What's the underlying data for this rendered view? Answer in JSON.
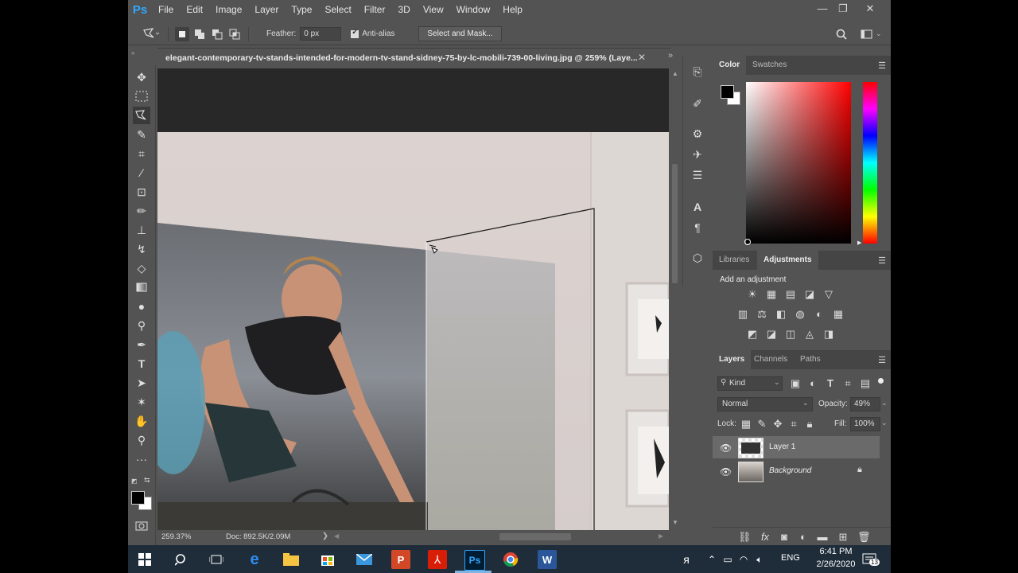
{
  "window": {
    "minimize": "—",
    "restore": "❐",
    "close": "✕"
  },
  "menu": [
    "File",
    "Edit",
    "Image",
    "Layer",
    "Type",
    "Select",
    "Filter",
    "3D",
    "View",
    "Window",
    "Help"
  ],
  "app_logo": "Ps",
  "options": {
    "feather_label": "Feather:",
    "feather_value": "0 px",
    "antialias_label": "Anti-alias",
    "antialias_checked": true,
    "select_mask_label": "Select and Mask..."
  },
  "document": {
    "tab_title": "elegant-contemporary-tv-stands-intended-for-modern-tv-stand-sidney-75-by-lc-mobili-739-00-living.jpg @ 259% (Laye...",
    "close": "✕",
    "zoom": "259.37%",
    "doc_info": "Doc: 892.5K/2.09M",
    "status_arrow": "❯"
  },
  "color_panel": {
    "tabs": [
      "Color",
      "Swatches"
    ],
    "foreground": "#000000",
    "background": "#ffffff",
    "hue_color": "#ff0000"
  },
  "adjust_panel": {
    "tabs": [
      "Libraries",
      "Adjustments"
    ],
    "heading": "Add an adjustment",
    "row1": [
      "☀",
      "▦",
      "▤",
      "◪",
      "▽"
    ],
    "row2": [
      "▥",
      "⚖",
      "◧",
      "◍",
      "◐",
      "▦"
    ],
    "row3": [
      "◩",
      "◪",
      "◫",
      "◬",
      "◨"
    ]
  },
  "layers_panel": {
    "tabs": [
      "Layers",
      "Channels",
      "Paths"
    ],
    "filter_kind": "Kind",
    "blend_mode": "Normal",
    "opacity_label": "Opacity:",
    "opacity_value": "49%",
    "lock_label": "Lock:",
    "fill_label": "Fill:",
    "fill_value": "100%",
    "layers": [
      {
        "name": "Layer 1",
        "visible": true,
        "selected": true
      },
      {
        "name": "Background",
        "visible": true,
        "locked": true,
        "italic": true
      }
    ]
  },
  "taskbar": {
    "language": "ENG",
    "time": "6:41 PM",
    "date": "2/26/2020",
    "notification_count": "13"
  }
}
